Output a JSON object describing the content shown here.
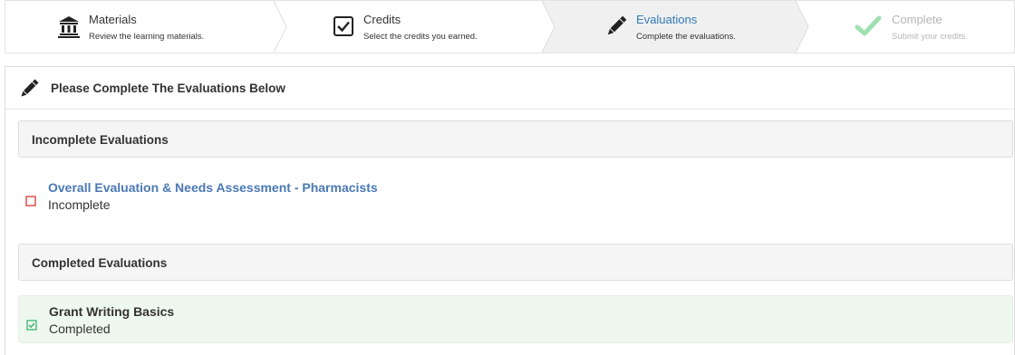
{
  "steps": [
    {
      "title": "Materials",
      "subtitle": "Review the learning materials.",
      "icon": "bank-icon",
      "state": "done"
    },
    {
      "title": "Credits",
      "subtitle": "Select the credits you earned.",
      "icon": "checkbox-icon",
      "state": "done"
    },
    {
      "title": "Evaluations",
      "subtitle": "Complete the evaluations.",
      "icon": "pencil-icon",
      "state": "active"
    },
    {
      "title": "Complete",
      "subtitle": "Submit your credits.",
      "icon": "checkmark-icon",
      "state": "pending"
    }
  ],
  "panel": {
    "title": "Please Complete The Evaluations Below",
    "icon": "pencil-icon"
  },
  "incomplete": {
    "heading": "Incomplete Evaluations",
    "items": [
      {
        "name": "Overall Evaluation & Needs Assessment - Pharmacists",
        "status": "Incomplete"
      }
    ]
  },
  "completed": {
    "heading": "Completed Evaluations",
    "items": [
      {
        "name": "Grant Writing Basics",
        "status": "Completed"
      }
    ]
  },
  "colors": {
    "active_step": "#337ab7",
    "link": "#4a78b5",
    "incomplete_box": "#d9534f",
    "complete_check": "#3cb371",
    "completed_row_bg": "#eff8ee",
    "pending_check": "#9fe0b0"
  }
}
